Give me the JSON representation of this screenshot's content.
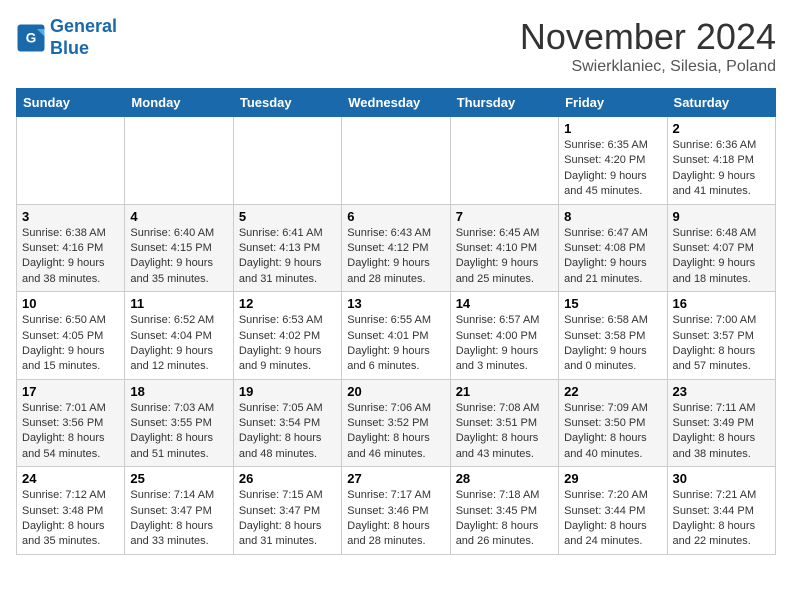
{
  "logo": {
    "line1": "General",
    "line2": "Blue"
  },
  "title": "November 2024",
  "location": "Swierklaniec, Silesia, Poland",
  "weekdays": [
    "Sunday",
    "Monday",
    "Tuesday",
    "Wednesday",
    "Thursday",
    "Friday",
    "Saturday"
  ],
  "weeks": [
    [
      {
        "day": "",
        "info": ""
      },
      {
        "day": "",
        "info": ""
      },
      {
        "day": "",
        "info": ""
      },
      {
        "day": "",
        "info": ""
      },
      {
        "day": "",
        "info": ""
      },
      {
        "day": "1",
        "info": "Sunrise: 6:35 AM\nSunset: 4:20 PM\nDaylight: 9 hours\nand 45 minutes."
      },
      {
        "day": "2",
        "info": "Sunrise: 6:36 AM\nSunset: 4:18 PM\nDaylight: 9 hours\nand 41 minutes."
      }
    ],
    [
      {
        "day": "3",
        "info": "Sunrise: 6:38 AM\nSunset: 4:16 PM\nDaylight: 9 hours\nand 38 minutes."
      },
      {
        "day": "4",
        "info": "Sunrise: 6:40 AM\nSunset: 4:15 PM\nDaylight: 9 hours\nand 35 minutes."
      },
      {
        "day": "5",
        "info": "Sunrise: 6:41 AM\nSunset: 4:13 PM\nDaylight: 9 hours\nand 31 minutes."
      },
      {
        "day": "6",
        "info": "Sunrise: 6:43 AM\nSunset: 4:12 PM\nDaylight: 9 hours\nand 28 minutes."
      },
      {
        "day": "7",
        "info": "Sunrise: 6:45 AM\nSunset: 4:10 PM\nDaylight: 9 hours\nand 25 minutes."
      },
      {
        "day": "8",
        "info": "Sunrise: 6:47 AM\nSunset: 4:08 PM\nDaylight: 9 hours\nand 21 minutes."
      },
      {
        "day": "9",
        "info": "Sunrise: 6:48 AM\nSunset: 4:07 PM\nDaylight: 9 hours\nand 18 minutes."
      }
    ],
    [
      {
        "day": "10",
        "info": "Sunrise: 6:50 AM\nSunset: 4:05 PM\nDaylight: 9 hours\nand 15 minutes."
      },
      {
        "day": "11",
        "info": "Sunrise: 6:52 AM\nSunset: 4:04 PM\nDaylight: 9 hours\nand 12 minutes."
      },
      {
        "day": "12",
        "info": "Sunrise: 6:53 AM\nSunset: 4:02 PM\nDaylight: 9 hours\nand 9 minutes."
      },
      {
        "day": "13",
        "info": "Sunrise: 6:55 AM\nSunset: 4:01 PM\nDaylight: 9 hours\nand 6 minutes."
      },
      {
        "day": "14",
        "info": "Sunrise: 6:57 AM\nSunset: 4:00 PM\nDaylight: 9 hours\nand 3 minutes."
      },
      {
        "day": "15",
        "info": "Sunrise: 6:58 AM\nSunset: 3:58 PM\nDaylight: 9 hours\nand 0 minutes."
      },
      {
        "day": "16",
        "info": "Sunrise: 7:00 AM\nSunset: 3:57 PM\nDaylight: 8 hours\nand 57 minutes."
      }
    ],
    [
      {
        "day": "17",
        "info": "Sunrise: 7:01 AM\nSunset: 3:56 PM\nDaylight: 8 hours\nand 54 minutes."
      },
      {
        "day": "18",
        "info": "Sunrise: 7:03 AM\nSunset: 3:55 PM\nDaylight: 8 hours\nand 51 minutes."
      },
      {
        "day": "19",
        "info": "Sunrise: 7:05 AM\nSunset: 3:54 PM\nDaylight: 8 hours\nand 48 minutes."
      },
      {
        "day": "20",
        "info": "Sunrise: 7:06 AM\nSunset: 3:52 PM\nDaylight: 8 hours\nand 46 minutes."
      },
      {
        "day": "21",
        "info": "Sunrise: 7:08 AM\nSunset: 3:51 PM\nDaylight: 8 hours\nand 43 minutes."
      },
      {
        "day": "22",
        "info": "Sunrise: 7:09 AM\nSunset: 3:50 PM\nDaylight: 8 hours\nand 40 minutes."
      },
      {
        "day": "23",
        "info": "Sunrise: 7:11 AM\nSunset: 3:49 PM\nDaylight: 8 hours\nand 38 minutes."
      }
    ],
    [
      {
        "day": "24",
        "info": "Sunrise: 7:12 AM\nSunset: 3:48 PM\nDaylight: 8 hours\nand 35 minutes."
      },
      {
        "day": "25",
        "info": "Sunrise: 7:14 AM\nSunset: 3:47 PM\nDaylight: 8 hours\nand 33 minutes."
      },
      {
        "day": "26",
        "info": "Sunrise: 7:15 AM\nSunset: 3:47 PM\nDaylight: 8 hours\nand 31 minutes."
      },
      {
        "day": "27",
        "info": "Sunrise: 7:17 AM\nSunset: 3:46 PM\nDaylight: 8 hours\nand 28 minutes."
      },
      {
        "day": "28",
        "info": "Sunrise: 7:18 AM\nSunset: 3:45 PM\nDaylight: 8 hours\nand 26 minutes."
      },
      {
        "day": "29",
        "info": "Sunrise: 7:20 AM\nSunset: 3:44 PM\nDaylight: 8 hours\nand 24 minutes."
      },
      {
        "day": "30",
        "info": "Sunrise: 7:21 AM\nSunset: 3:44 PM\nDaylight: 8 hours\nand 22 minutes."
      }
    ]
  ]
}
